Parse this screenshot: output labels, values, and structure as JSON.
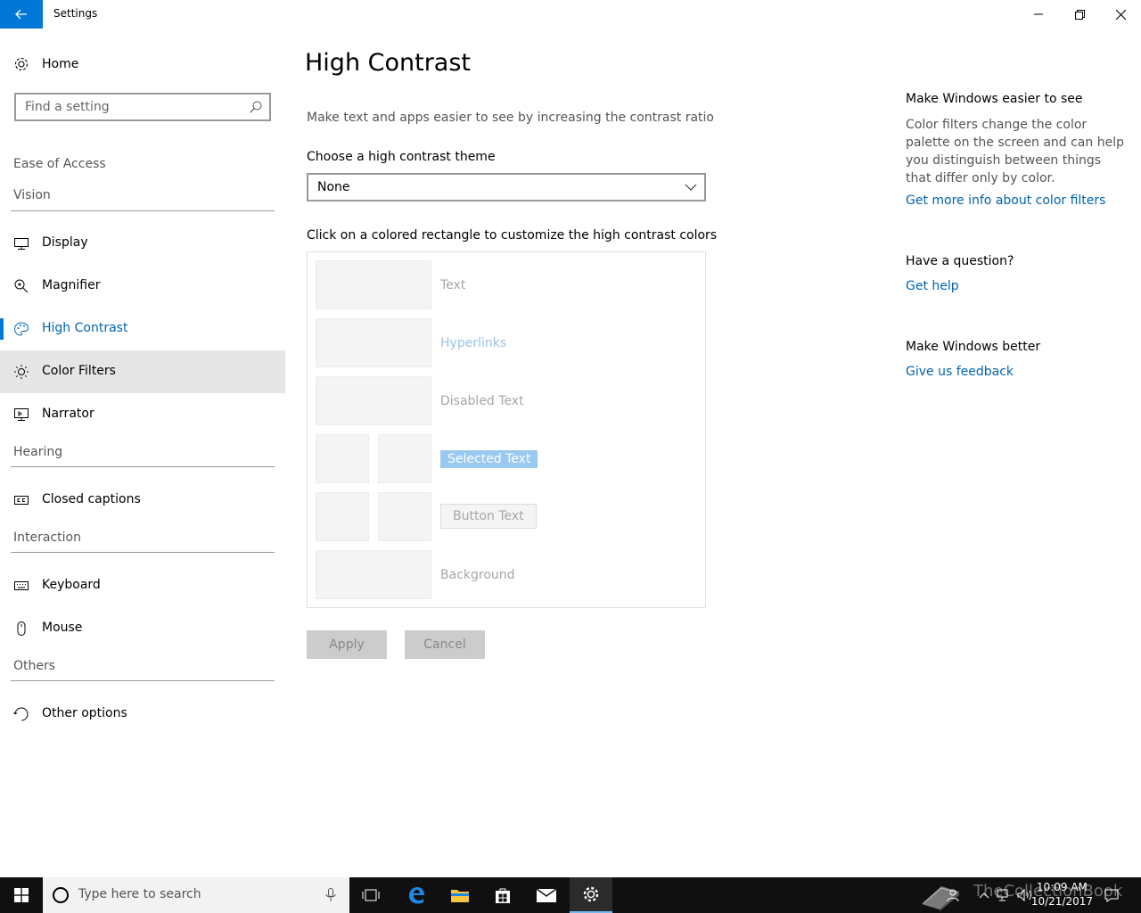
{
  "window": {
    "title": "Settings"
  },
  "sidebar": {
    "home_label": "Home",
    "search_placeholder": "Find a setting",
    "category": "Ease of Access",
    "sections": {
      "vision": "Vision",
      "hearing": "Hearing",
      "interaction": "Interaction",
      "others": "Others"
    },
    "items": {
      "display": "Display",
      "magnifier": "Magnifier",
      "high_contrast": "High Contrast",
      "color_filters": "Color Filters",
      "narrator": "Narrator",
      "closed_captions": "Closed captions",
      "keyboard": "Keyboard",
      "mouse": "Mouse",
      "other_options": "Other options"
    }
  },
  "main": {
    "title": "High Contrast",
    "description": "Make text and apps easier to see by increasing the contrast ratio",
    "theme_label": "Choose a high contrast theme",
    "theme_value": "None",
    "colors_label": "Click on a colored rectangle to customize the high contrast colors",
    "swatches": {
      "text": "Text",
      "hyperlinks": "Hyperlinks",
      "disabled_text": "Disabled Text",
      "selected_text": "Selected Text",
      "button_text": "Button Text",
      "background": "Background"
    },
    "apply_label": "Apply",
    "cancel_label": "Cancel"
  },
  "right_pane": {
    "easier_heading": "Make Windows easier to see",
    "easier_body": "Color filters change the color palette on the screen and can help you distinguish between things that differ only by color.",
    "easier_link": "Get more info about color filters",
    "question_heading": "Have a question?",
    "help_link": "Get help",
    "better_heading": "Make Windows better",
    "feedback_link": "Give us feedback"
  },
  "taskbar": {
    "search_placeholder": "Type here to search",
    "time": "10:09 AM",
    "date": "10/21/2017",
    "watermark": "TheCollectionBook"
  },
  "colors": {
    "accent": "#0078d7",
    "link": "#0063b1",
    "taskbar": "#101010"
  }
}
